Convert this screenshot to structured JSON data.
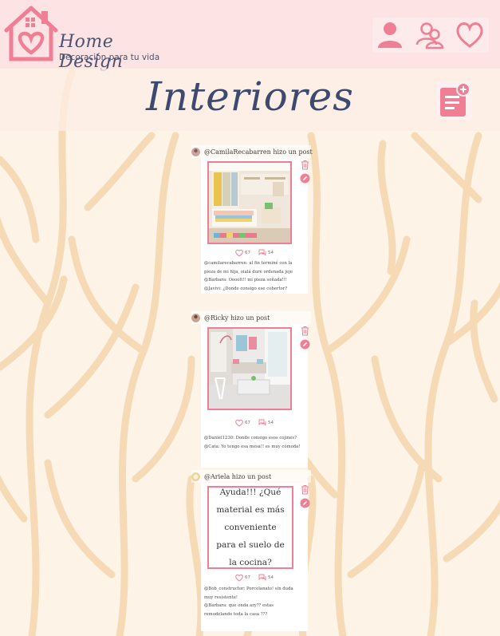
{
  "brand": {
    "name": "Home Design",
    "tagline": "Decoración para tu vida",
    "accent": "#f07f95",
    "text_color": "#3d4a70"
  },
  "nav": [
    {
      "name": "profile",
      "icon": "user-icon"
    },
    {
      "name": "friends",
      "icon": "users-icon"
    },
    {
      "name": "favorites",
      "icon": "heart-icon"
    }
  ],
  "page": {
    "title": "Interiores",
    "new_post_icon": "note-plus-icon"
  },
  "posts": [
    {
      "author_line": "@CamilaRecabarren hizo un post",
      "content_type": "image",
      "image_desc": "kids-bedroom-photo",
      "likes": "67",
      "comments_count": "54",
      "comments": [
        "@camilarecabarren: al fin terminé con la",
        "pieza de mi hija, oialá dure ordenada jeje",
        "@Barbara: Oooolt!! mi pieza soñada!!!",
        "@Javivi: ¿Donde consigo ese cobertor?"
      ]
    },
    {
      "author_line": "@Ricky hizo un post",
      "content_type": "image",
      "image_desc": "living-room-photo",
      "likes": "67",
      "comments_count": "54",
      "comments": [
        "@Daniel1230: Donde consigo esos cojines?",
        "@Cata: Yo tengo esa mesa!! es muy cómoda!"
      ]
    },
    {
      "author_line": "@Ariela hizo un post",
      "content_type": "text",
      "text": "Ayuda!!! ¿Qué material es más conveniente para el suelo de la cocina?",
      "likes": "67",
      "comments_count": "54",
      "comments": [
        "@Bob_constructor: Porcelanato! sin duda",
        "muy resistente!",
        "@Barbara: que onda ary?? estas",
        "remodelando toda la casa ???"
      ]
    }
  ]
}
